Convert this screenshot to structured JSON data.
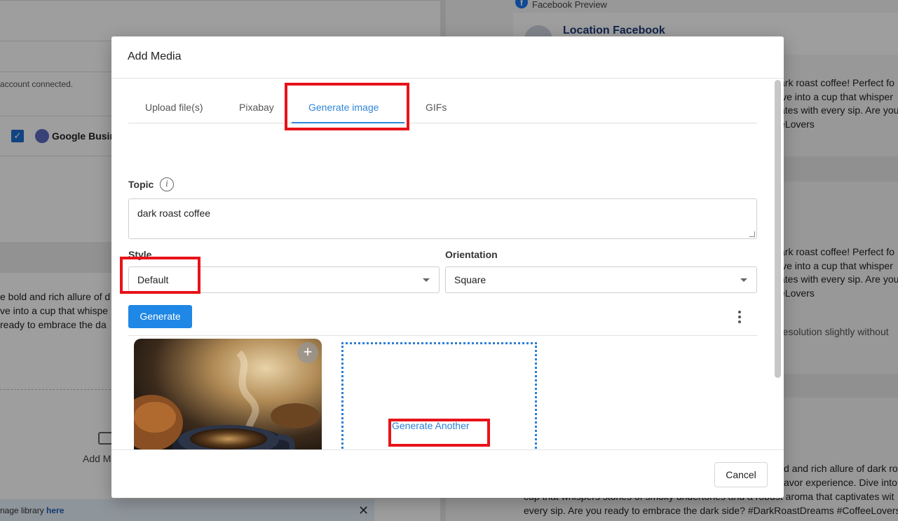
{
  "background": {
    "left": {
      "account_note": "account connected.",
      "google_business_label": "Google Busine",
      "post_lines": [
        "e bold and rich allure of d",
        "ve into a cup that whispe",
        "ready to embrace the da"
      ],
      "add_media_label": "Add M",
      "library_text": "nage library ",
      "library_link": "here"
    },
    "right": {
      "preview_label": "Facebook Preview",
      "page_name": "Location Facebook",
      "block1": [
        "ark roast coffee! Perfect fo",
        "ive into a cup that whisper",
        "ates with every sip. Are you",
        "eLovers"
      ],
      "block2": [
        "ark roast coffee! Perfect fo",
        "ive into a cup that whisper",
        "ates with every sip. Are you",
        "eLovers"
      ],
      "resolution_note": "resolution slightly without",
      "block3": [
        "d and rich allure of dark roa",
        "avor experience. Dive into",
        "cup that whispers stories of smoky undertones and a robust aroma that captivates wit",
        "every sip. Are you ready to embrace the dark side? #DarkRoastDreams #CoffeeLovers"
      ]
    }
  },
  "modal": {
    "title": "Add Media",
    "tabs": [
      {
        "label": "Upload file(s)"
      },
      {
        "label": "Pixabay"
      },
      {
        "label": "Generate image"
      },
      {
        "label": "GIFs"
      }
    ],
    "active_tab": "Generate image",
    "topic": {
      "label": "Topic",
      "value": "dark roast coffee"
    },
    "style": {
      "label": "Style",
      "selected": "Default"
    },
    "orientation": {
      "label": "Orientation",
      "selected": "Square"
    },
    "generate_label": "Generate",
    "generate_another_label": "Generate Another",
    "cancel_label": "Cancel"
  },
  "colors": {
    "accent": "#1f87e5",
    "link": "#2c7fd4",
    "highlight": "#e8131a"
  }
}
